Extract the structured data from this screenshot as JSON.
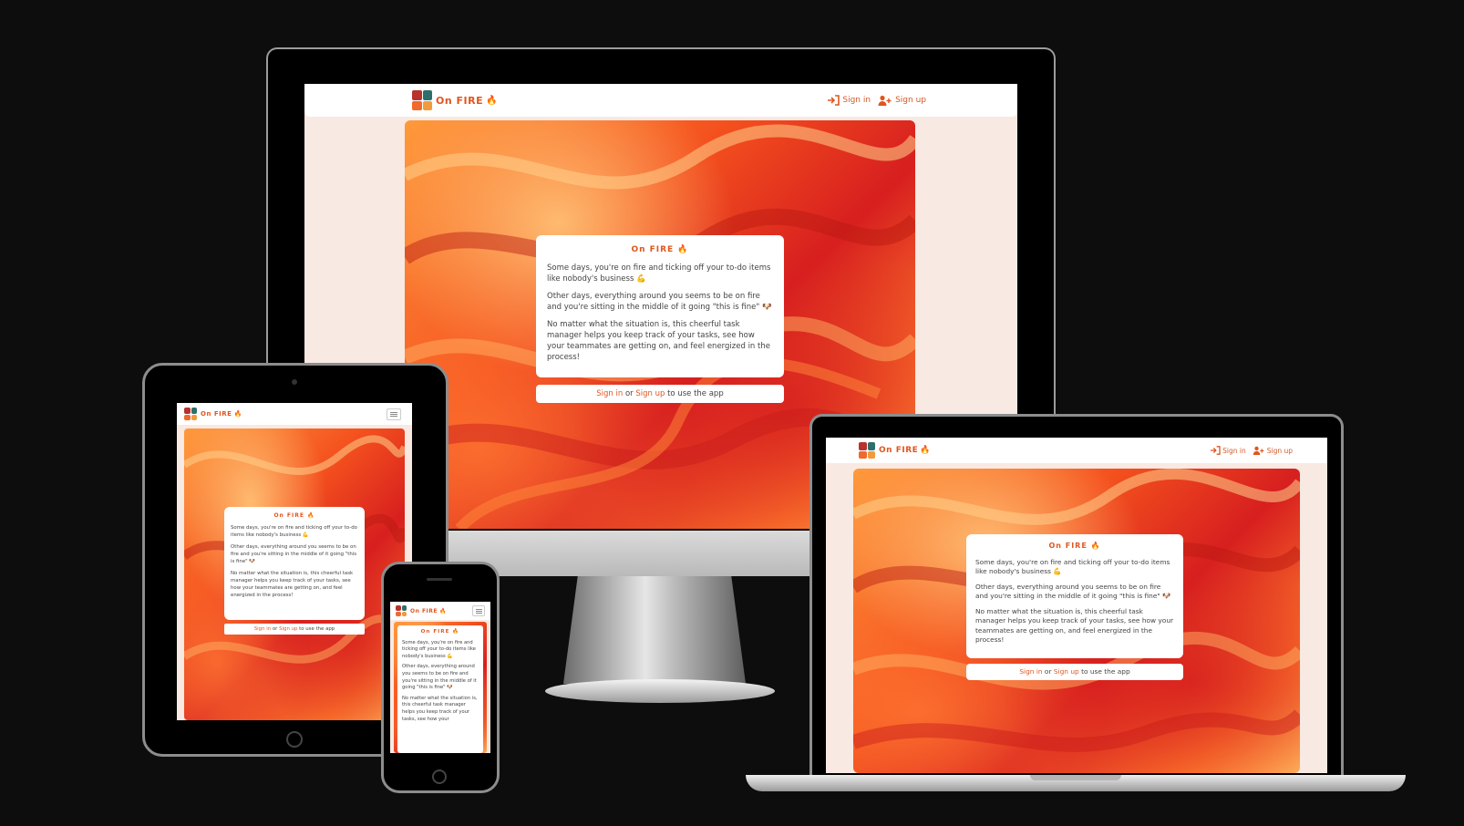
{
  "app": {
    "brand": "On FIRE",
    "brand_emoji": "🔥",
    "nav": {
      "sign_in": "Sign in",
      "sign_up": "Sign up"
    },
    "card": {
      "title": "On FIRE 🔥",
      "p1": "Some days, you're on fire and ticking off your to-do items like nobody's business 💪",
      "p2": "Other days, everything around you seems to be on fire and you're sitting in the middle of it going \"this is fine\" 🐶",
      "p3": "No matter what the situation is, this cheerful task manager helps you keep track of your tasks, see how your teammates are getting on, and feel energized in the process!",
      "p3_short": "No matter what the situation is, this cheerful task manager helps you keep track of your tasks, see how your"
    },
    "cta": {
      "sign_in": "Sign in",
      "or": "or",
      "sign_up": "Sign up",
      "suffix": "to use the app"
    }
  },
  "colors": {
    "accent": "#e0561f",
    "background": "#0d0d0d",
    "page_bg": "#f8e9e2"
  },
  "icons": {
    "sign_in": "sign-in-icon",
    "sign_up": "add-user-icon",
    "menu": "hamburger-icon",
    "logo": "four-square-logo-icon"
  }
}
